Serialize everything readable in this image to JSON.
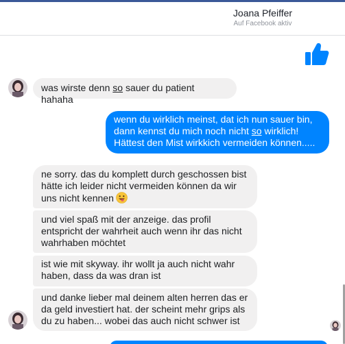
{
  "header": {
    "name": "Joana Pfeiffer",
    "status": "Auf Facebook aktiv"
  },
  "colors": {
    "facebook_blue": "#3b5998",
    "outgoing_bubble": "#0084ff",
    "incoming_bubble": "#f1f0f0",
    "like_blue": "#0084ff"
  },
  "icons": {
    "like": "thumbs-up-icon",
    "emoji": "grinning-tongue-emoji-icon"
  },
  "messages": [
    {
      "id": "m1",
      "direction": "incoming",
      "parts": [
        "was wirste denn ",
        "so",
        " sauer du patient hahaha"
      ]
    },
    {
      "id": "m2",
      "direction": "outgoing",
      "line1": "wenn du wirklich meinst, dat ich nun sauer bin,",
      "line2_parts": [
        "dann kennst du mich noch nicht ",
        "so",
        " wirklich!"
      ],
      "line3": "Hättest den Mist wirkkich vermeiden können....."
    },
    {
      "id": "m3",
      "direction": "incoming",
      "line1": "ne sorry. das du komplett durch geschossen bist",
      "line2": "hätte ich leider nicht vermeiden können da wir",
      "line3": "uns nicht kennen"
    },
    {
      "id": "m4",
      "direction": "incoming",
      "line1": "und viel spaß mit der anzeige. das profil",
      "line2": "entspricht der wahrheit auch wenn ihr das nicht",
      "line3": "wahrhaben möchtet"
    },
    {
      "id": "m5",
      "direction": "incoming",
      "line1": "ist wie mit skyway. ihr wollt ja auch nicht wahr",
      "line2": "haben, dass da was dran ist"
    },
    {
      "id": "m6",
      "direction": "incoming",
      "line1": "und danke lieber mal deinem alten herren das er",
      "line2": "da geld investiert hat. der scheint mehr grips als",
      "line3": "du zu haben... wobei das auch nicht schwer ist"
    }
  ]
}
